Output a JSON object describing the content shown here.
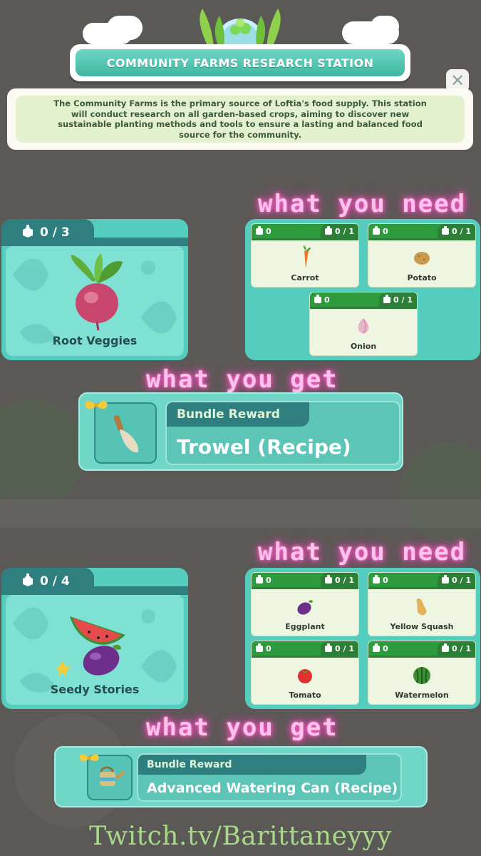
{
  "header": {
    "title": "COMMUNITY FARMS RESEARCH STATION",
    "description": "The Community Farms is the primary source of Loftia's food supply. This station will conduct research on all garden-based crops, aiming to discover new sustainable planting methods and tools to ensure a lasting and balanced food source for the community."
  },
  "labels": {
    "what_you_need": "what you need",
    "what_you_get": "what you get"
  },
  "bundles": [
    {
      "name": "Root Veggies",
      "progress": "0 / 3",
      "items": [
        {
          "name": "Carrot",
          "owned": "0",
          "req": "0 / 1"
        },
        {
          "name": "Potato",
          "owned": "0",
          "req": "0 / 1"
        },
        {
          "name": "Onion",
          "owned": "0",
          "req": "0 / 1"
        }
      ],
      "reward": {
        "label": "Bundle Reward",
        "title": "Trowel (Recipe)"
      }
    },
    {
      "name": "Seedy Stories",
      "progress": "0 / 4",
      "items": [
        {
          "name": "Eggplant",
          "owned": "0",
          "req": "0 / 1"
        },
        {
          "name": "Yellow Squash",
          "owned": "0",
          "req": "0 / 1"
        },
        {
          "name": "Tomato",
          "owned": "0",
          "req": "0 / 1"
        },
        {
          "name": "Watermelon",
          "owned": "0",
          "req": "0 / 1"
        }
      ],
      "reward": {
        "label": "Bundle Reward",
        "title": "Advanced Watering Can (Recipe)"
      }
    }
  ],
  "footer": {
    "twitch": "Twitch.tv/Barittaneyyy"
  },
  "colors": {
    "teal": "#54cdbf",
    "dark_teal": "#2f7f80",
    "green_head": "#2e9a3e",
    "neon_pink": "#ffc3ec"
  }
}
